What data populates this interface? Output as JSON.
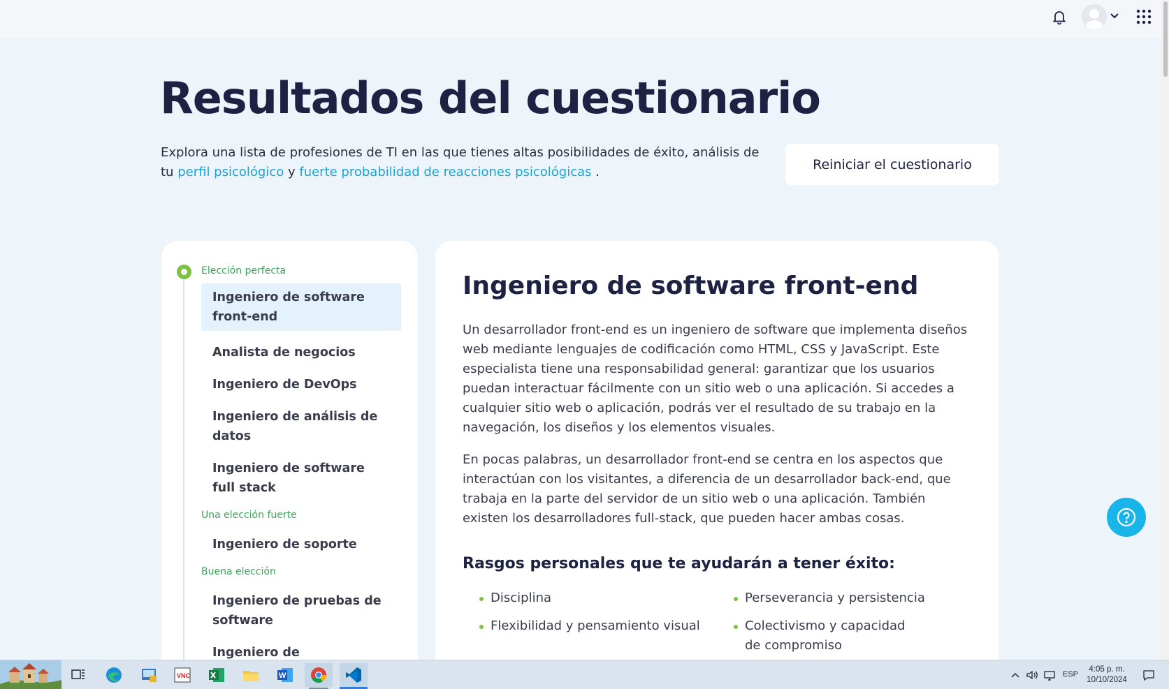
{
  "header": {
    "title": "Resultados del cuestionario",
    "intro_prefix": "Explora una lista de profesiones de TI en las que tienes altas posibilidades de éxito, análisis de tu",
    "link_profile": "perfil psicológico",
    "intro_middle": "y",
    "link_reactions": "fuerte probabilidad de reacciones psicológicas",
    "intro_suffix": ".",
    "restart_button": "Reiniciar el cuestionario"
  },
  "topbar": {
    "icons": [
      "bell-icon",
      "avatar",
      "chevron-down-icon",
      "apps-grid-icon"
    ]
  },
  "sidebar": {
    "groups": [
      {
        "label": "Elección perfecta"
      },
      {
        "label": "Una elección fuerte"
      },
      {
        "label": "Buena elección"
      }
    ],
    "items": [
      {
        "label": "Ingeniero de software front-end",
        "active": true
      },
      {
        "label": "Analista de negocios"
      },
      {
        "label": "Ingeniero de DevOps"
      },
      {
        "label": "Ingeniero de análisis de datos"
      },
      {
        "label": "Ingeniero de software full stack"
      },
      {
        "label": "Ingeniero de soporte"
      },
      {
        "label": "Ingeniero de pruebas de software"
      },
      {
        "label": "Ingeniero de automatización"
      }
    ]
  },
  "detail": {
    "title": "Ingeniero de software front-end",
    "paragraphs": [
      "Un desarrollador front-end es un ingeniero de software que implementa diseños web mediante lenguajes de codificación como HTML, CSS y JavaScript. Este especialista tiene una responsabilidad general: garantizar que los usuarios puedan interactuar fácilmente con un sitio web o una aplicación. Si accedes a cualquier sitio web o aplicación, podrás ver el resultado de su trabajo en la navegación, los diseños y los elementos visuales.",
      "En pocas palabras, un desarrollador front-end se centra en los aspectos que interactúan con los visitantes, a diferencia de un desarrollador back-end, que trabaja en la parte del servidor de un sitio web o una aplicación. También existen los desarrolladores full-stack, que pueden hacer ambas cosas."
    ],
    "traits_title": "Rasgos personales que te ayudarán a tener éxito:",
    "traits": [
      "Disciplina",
      "Perseverancia y persistencia",
      "Flexibilidad y pensamiento visual",
      "Colectivismo y capacidad de compromiso"
    ]
  },
  "taskbar": {
    "apps": [
      "town-thumbnail",
      "task-view-icon",
      "edge-icon",
      "control-panel-icon",
      "vnc-icon",
      "excel-icon",
      "file-explorer-icon",
      "word-icon",
      "chrome-icon",
      "vscode-icon"
    ],
    "language": "ESP",
    "time": "4:05 p. m.",
    "date": "10/10/2024"
  },
  "colors": {
    "accent_link": "#1aa3d6",
    "accent_green": "#7cc242",
    "title_navy": "#1d2142",
    "help_button": "#1ab5e8"
  }
}
